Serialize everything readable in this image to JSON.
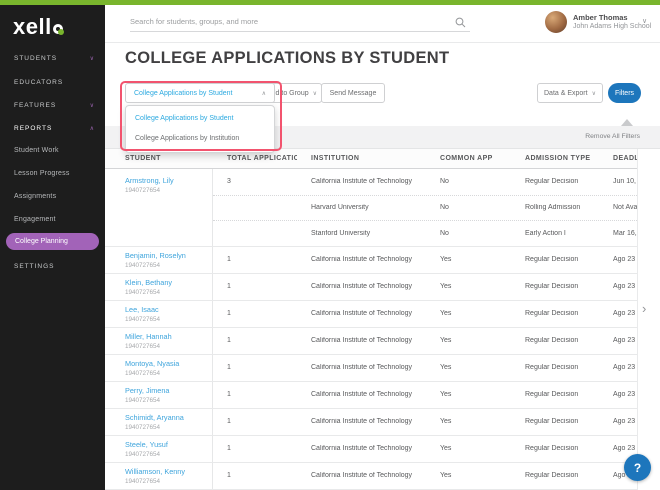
{
  "brand": {
    "name": "xello",
    "logo_prefix": "xell"
  },
  "sidebar": {
    "items": [
      {
        "label": "STUDENTS",
        "chevron": "∨"
      },
      {
        "label": "EDUCATORS",
        "chevron": ""
      },
      {
        "label": "FEATURES",
        "chevron": "∨"
      },
      {
        "label": "REPORTS",
        "chevron": "∧"
      }
    ],
    "report_items": [
      "Student Work",
      "Lesson Progress",
      "Assignments",
      "Engagement",
      "College Planning"
    ],
    "active_report_item": "College Planning",
    "settings_label": "SETTINGS"
  },
  "header": {
    "search_placeholder": "Search for students, groups, and more",
    "user_name": "Amber Thomas",
    "user_school": "John Adams High School",
    "user_chevron": "∨"
  },
  "page": {
    "title": "COLLEGE APPLICATIONS BY STUDENT"
  },
  "toolbar": {
    "report_dropdown": {
      "selected": "College Applications by Student",
      "chevron": "∧",
      "options": [
        "College Applications by Student",
        "College Applications by Institution"
      ]
    },
    "add_to_group_label": "Add to Group",
    "add_to_group_chevron": "∨",
    "send_message_label": "Send Message",
    "data_export_label": "Data & Export",
    "data_export_chevron": "∨",
    "filters_label": "Filters"
  },
  "filter_bar": {
    "remove_all_label": "Remove All Filters"
  },
  "table": {
    "columns": [
      "STUDENT",
      "TOTAL APPLICATIONS",
      "INSTITUTION",
      "COMMON APP",
      "ADMISSION TYPE",
      "DEADLINE"
    ],
    "rows": [
      {
        "student": "Armstrong, Lily",
        "id": "1940727654",
        "total": "3",
        "applications": [
          {
            "institution": "California Institute of Technology",
            "common_app": "No",
            "admission_type": "Regular Decision",
            "deadline": "Jun 10,"
          },
          {
            "institution": "Harvard University",
            "common_app": "No",
            "admission_type": "Rolling Admission",
            "deadline": "Not Ava"
          },
          {
            "institution": "Stanford University",
            "common_app": "No",
            "admission_type": "Early Action I",
            "deadline": "Mar 16,"
          }
        ]
      },
      {
        "student": "Benjamin, Roselyn",
        "id": "1940727654",
        "total": "1",
        "applications": [
          {
            "institution": "California Institute of Technology",
            "common_app": "Yes",
            "admission_type": "Regular Decision",
            "deadline": "Ago 23"
          }
        ]
      },
      {
        "student": "Klein, Bethany",
        "id": "1940727654",
        "total": "1",
        "applications": [
          {
            "institution": "California Institute of Technology",
            "common_app": "Yes",
            "admission_type": "Regular Decision",
            "deadline": "Ago 23"
          }
        ]
      },
      {
        "student": "Lee, Isaac",
        "id": "1940727654",
        "total": "1",
        "applications": [
          {
            "institution": "California Institute of Technology",
            "common_app": "Yes",
            "admission_type": "Regular Decision",
            "deadline": "Ago 23"
          }
        ]
      },
      {
        "student": "Miller, Hannah",
        "id": "1940727654",
        "total": "1",
        "applications": [
          {
            "institution": "California Institute of Technology",
            "common_app": "Yes",
            "admission_type": "Regular Decision",
            "deadline": "Ago 23"
          }
        ]
      },
      {
        "student": "Montoya, Nyasia",
        "id": "1940727654",
        "total": "1",
        "applications": [
          {
            "institution": "California Institute of Technology",
            "common_app": "Yes",
            "admission_type": "Regular Decision",
            "deadline": "Ago 23"
          }
        ]
      },
      {
        "student": "Perry, Jimena",
        "id": "1940727654",
        "total": "1",
        "applications": [
          {
            "institution": "California Institute of Technology",
            "common_app": "Yes",
            "admission_type": "Regular Decision",
            "deadline": "Ago 23"
          }
        ]
      },
      {
        "student": "Schimidt, Aryanna",
        "id": "1940727654",
        "total": "1",
        "applications": [
          {
            "institution": "California Institute of Technology",
            "common_app": "Yes",
            "admission_type": "Regular Decision",
            "deadline": "Ago 23"
          }
        ]
      },
      {
        "student": "Steele, Yusuf",
        "id": "1940727654",
        "total": "1",
        "applications": [
          {
            "institution": "California Institute of Technology",
            "common_app": "Yes",
            "admission_type": "Regular Decision",
            "deadline": "Ago 23"
          }
        ]
      },
      {
        "student": "Williamson, Kenny",
        "id": "1940727654",
        "total": "1",
        "applications": [
          {
            "institution": "California Institute of Technology",
            "common_app": "Yes",
            "admission_type": "Regular Decision",
            "deadline": "Ago 23"
          }
        ]
      }
    ]
  },
  "floating": {
    "help_label": "?",
    "scroll_right_glyph": "›"
  },
  "colors": {
    "accent_green": "#79b52d",
    "accent_purple": "#a263b8",
    "link_blue": "#3ea4dc",
    "button_blue": "#1d76bc",
    "annotation_red": "#f2536e"
  }
}
